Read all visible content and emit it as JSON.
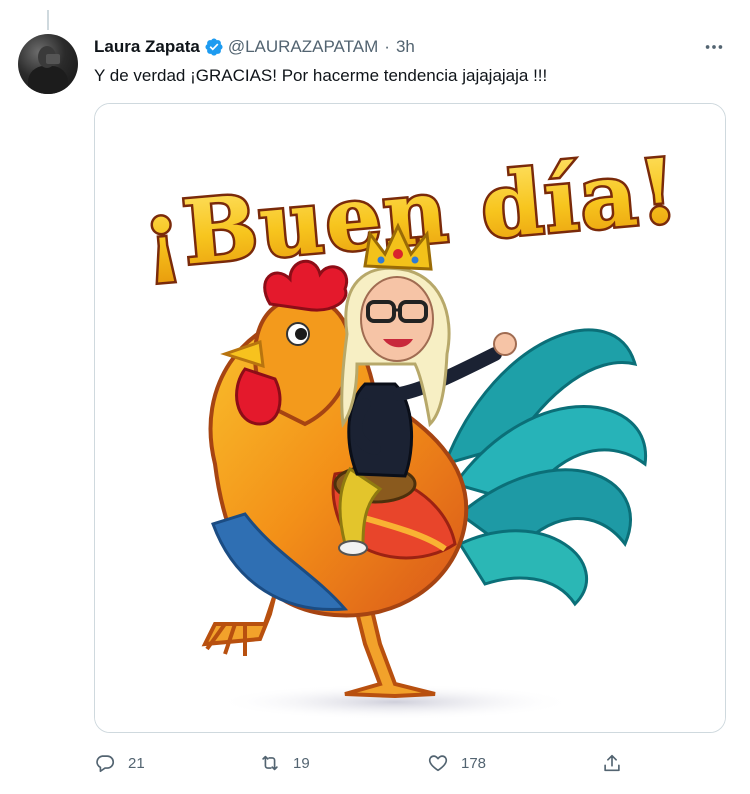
{
  "tweet": {
    "author_name": "Laura Zapata",
    "handle": "@LAURAZAPATAM",
    "separator": "·",
    "time": "3h",
    "text": "Y de verdad ¡GRACIAS! Por hacerme tendencia jajajajaja !!!",
    "image_text": "¡Buen día!"
  },
  "actions": {
    "reply_count": "21",
    "retweet_count": "19",
    "like_count": "178"
  },
  "icons": {
    "verified": "verified-badge-icon",
    "more": "more-options-icon",
    "reply": "reply-icon",
    "retweet": "retweet-icon",
    "like": "heart-icon",
    "share": "share-icon"
  },
  "colors": {
    "verified_blue": "#1d9bf0",
    "secondary_text": "#536471",
    "title_gold": "#f7c51e",
    "title_outline": "#7a2a0a"
  }
}
